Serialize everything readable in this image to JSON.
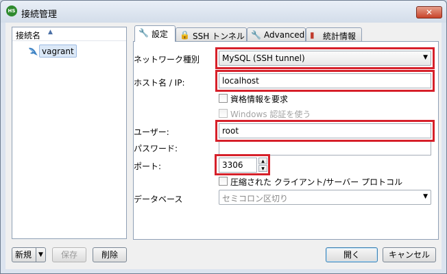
{
  "window": {
    "title": "接続管理",
    "app_icon_text": "HS",
    "close_label": "✕"
  },
  "session_list": {
    "column_header": "接続名",
    "sort_indicator": "▲",
    "items": [
      {
        "label": "vagrant",
        "icon": "dolphin-icon"
      }
    ]
  },
  "left_buttons": {
    "new": "新規",
    "save": "保存",
    "delete": "削除"
  },
  "tabs": [
    {
      "label": "設定",
      "icon": "wrench-icon",
      "active": true
    },
    {
      "label": "SSH トンネル",
      "icon": "lock-icon",
      "active": false
    },
    {
      "label": "Advanced",
      "icon": "wrench-orange-icon",
      "active": false
    },
    {
      "label": "統計情報",
      "icon": "bar-chart-icon",
      "active": false
    }
  ],
  "settings": {
    "network_type_label": "ネットワーク種別",
    "network_type_value": "MySQL (SSH tunnel)",
    "host_label": "ホスト名 / IP:",
    "host_value": "localhost",
    "require_credentials": "資格情報を要求",
    "windows_auth": "Windows 認証を使う",
    "user_label": "ユーザー:",
    "user_value": "root",
    "password_label": "パスワード:",
    "password_value": "",
    "port_label": "ポート:",
    "port_value": "3306",
    "compressed_protocol": "圧縮された クライアント/サーバー プロトコル",
    "database_label": "データベース",
    "database_placeholder": "セミコロン区切り"
  },
  "footer_buttons": {
    "open": "開く",
    "cancel": "キャンセル"
  },
  "colors": {
    "highlight": "#d6202a",
    "selection": "#dbe8f7"
  }
}
